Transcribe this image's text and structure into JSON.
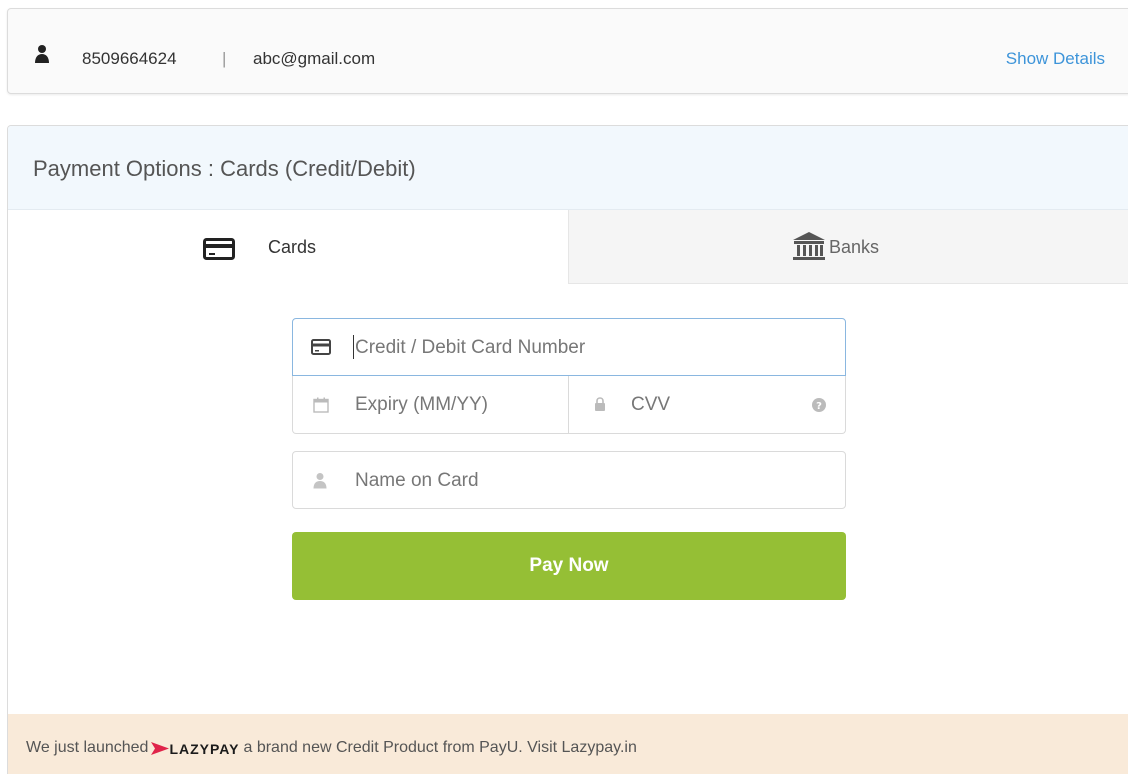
{
  "user": {
    "phone": "8509664624",
    "separator": "|",
    "email": "abc@gmail.com",
    "show_details_label": "Show Details",
    "icon": "user-icon"
  },
  "panel": {
    "title": "Payment Options : Cards (Credit/Debit)"
  },
  "tabs": [
    {
      "label": "Cards",
      "icon": "credit-card-icon",
      "active": true
    },
    {
      "label": "Banks",
      "icon": "bank-icon",
      "active": false
    }
  ],
  "form": {
    "card_number_placeholder": "Credit / Debit Card Number",
    "expiry_placeholder": "Expiry (MM/YY)",
    "cvv_placeholder": "CVV",
    "name_placeholder": "Name on Card",
    "pay_button_label": "Pay Now"
  },
  "promo": {
    "prefix": "We just launched",
    "logo_text": "LAZYPAY",
    "suffix": "a brand new Credit Product from PayU. Visit Lazypay.in"
  },
  "colors": {
    "accent_link": "#3d94d9",
    "pay_button": "#95bf35",
    "header_bg": "#f2f8fd",
    "promo_bg": "#f9ead9",
    "lazypay_logo": "#e0244a"
  }
}
